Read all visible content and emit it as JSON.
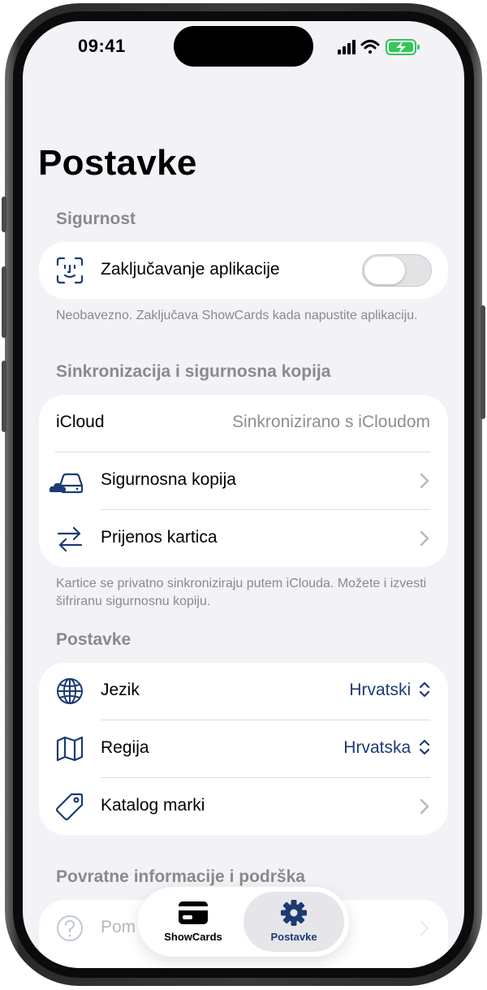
{
  "status": {
    "time": "09:41"
  },
  "page": {
    "title": "Postavke"
  },
  "security": {
    "header": "Sigurnost",
    "app_lock": {
      "label": "Zaključavanje aplikacije",
      "enabled": false,
      "icon": "face-id-icon"
    },
    "footnote": "Neobavezno. Zaključava ShowCards kada napustite aplikaciju."
  },
  "sync": {
    "header": "Sinkronizacija i sigurnosna kopija",
    "icloud": {
      "label": "iCloud",
      "value": "Sinkronizirano s iCloudom"
    },
    "backup": {
      "label": "Sigurnosna kopija",
      "icon": "cloud-drive-icon"
    },
    "transfer": {
      "label": "Prijenos kartica",
      "icon": "transfer-arrows-icon"
    },
    "footnote": "Kartice se privatno sinkroniziraju putem iClouda. Možete i izvesti šifriranu sigurnosnu kopiju."
  },
  "settings": {
    "header": "Postavke",
    "language": {
      "label": "Jezik",
      "value": "Hrvatski",
      "icon": "globe-icon"
    },
    "region": {
      "label": "Regija",
      "value": "Hrvatska",
      "icon": "map-icon"
    },
    "brand_catalog": {
      "label": "Katalog marki",
      "icon": "tag-icon"
    }
  },
  "feedback": {
    "header": "Povratne informacije i podrška",
    "help_partial": "Pom"
  },
  "tabbar": {
    "items": [
      {
        "label": "ShowCards",
        "icon": "card-icon",
        "active": false
      },
      {
        "label": "Postavke",
        "icon": "gear-icon",
        "active": true
      }
    ]
  },
  "colors": {
    "accent": "#1c3b73",
    "secondary_text": "#8a8a8e",
    "background": "#f2f2f7"
  }
}
